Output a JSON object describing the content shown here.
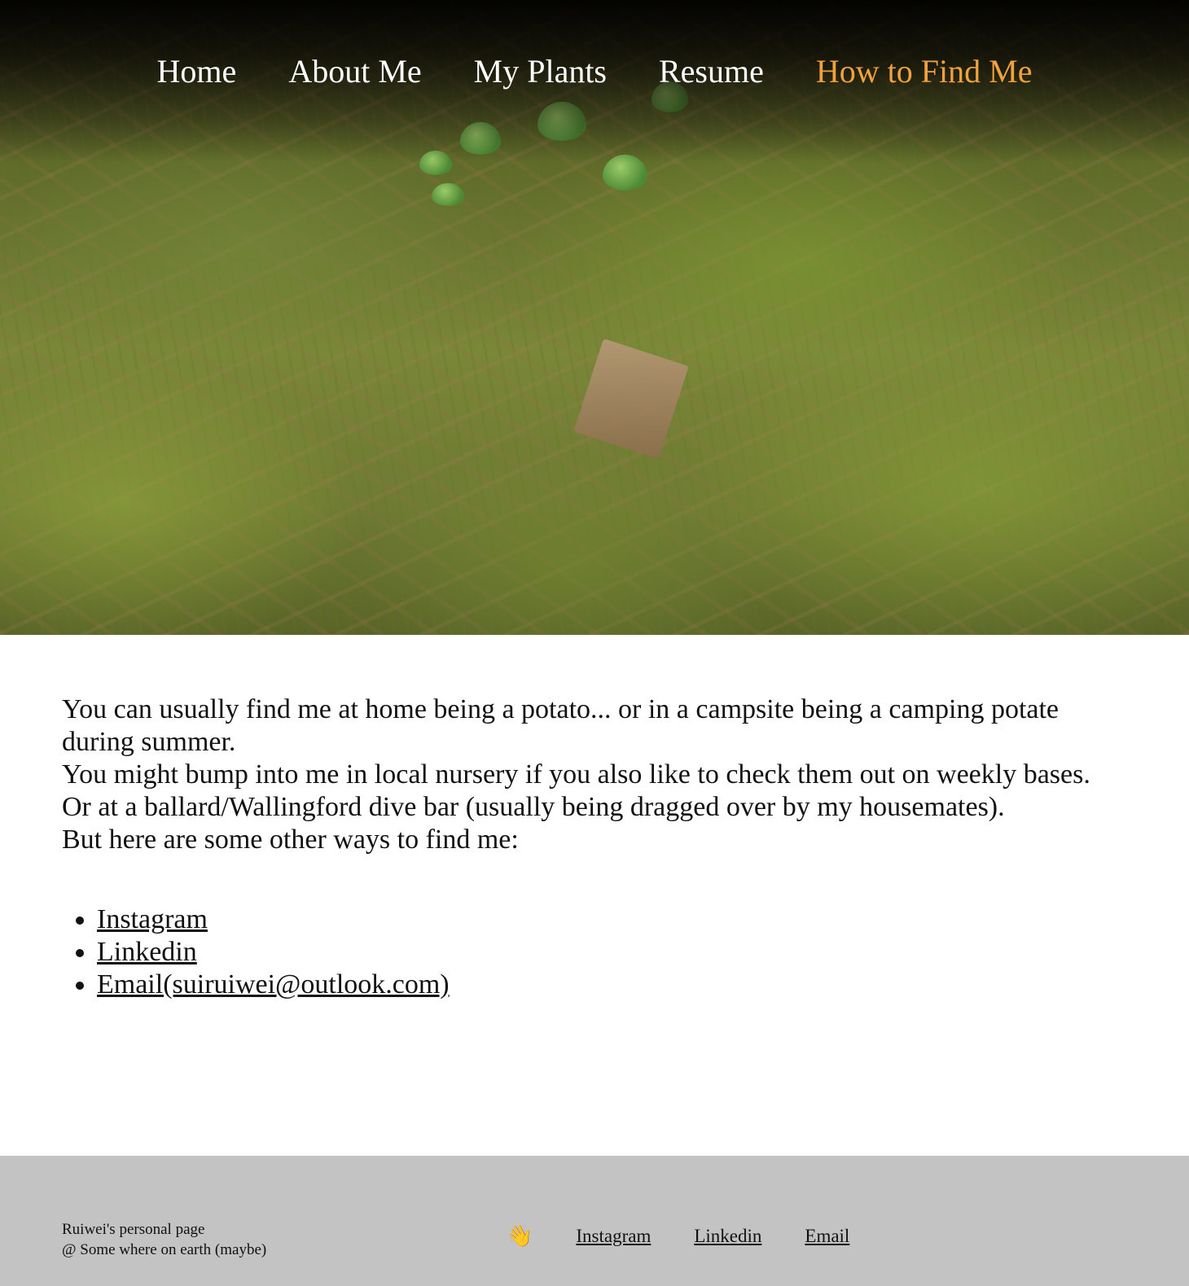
{
  "nav": {
    "items": [
      {
        "label": "Home",
        "active": false
      },
      {
        "label": "About Me",
        "active": false
      },
      {
        "label": "My Plants",
        "active": false
      },
      {
        "label": "Resume",
        "active": false
      },
      {
        "label": "How to Find Me",
        "active": true
      }
    ],
    "active_color": "#f2a23c"
  },
  "main": {
    "paragraphs": [
      "You can usually find me at home being a potato... or in a campsite being a camping potate during summer.",
      "You might bump into me in local nursery if you also like to check them out on weekly bases.",
      "Or at a ballard/Wallingford dive bar (usually being dragged over by my housemates).",
      "But here are some other ways to find me:"
    ],
    "links": [
      "Instagram",
      "Linkedin",
      "Email(suiruiwei@outlook.com)"
    ]
  },
  "footer": {
    "line1": "Ruiwei's personal page",
    "line2": "@ Some where on earth (maybe)",
    "wave_icon": "👋",
    "links": [
      "Instagram",
      "Linkedin",
      "Email"
    ],
    "background": "#c3c3c3"
  }
}
